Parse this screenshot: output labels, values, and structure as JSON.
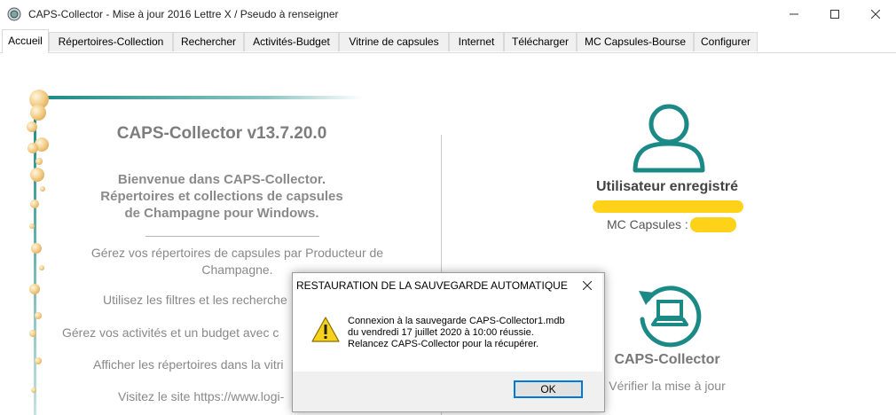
{
  "window": {
    "title": "CAPS-Collector - Mise à jour 2016 Lettre X / Pseudo à renseigner",
    "icon": "caps-icon",
    "controls": [
      "minimize-icon",
      "maximize-icon",
      "close-icon"
    ]
  },
  "tabs": [
    {
      "label": "Accueil",
      "active": true
    },
    {
      "label": "Répertoires-Collection"
    },
    {
      "label": "Rechercher"
    },
    {
      "label": "Activités-Budget"
    },
    {
      "label": "Vitrine de capsules"
    },
    {
      "label": "Internet"
    },
    {
      "label": "Télécharger"
    },
    {
      "label": "MC Capsules-Bourse"
    },
    {
      "label": "Configurer"
    }
  ],
  "home": {
    "title": "CAPS-Collector v13.7.20.0",
    "welcome": [
      "Bienvenue dans CAPS-Collector.",
      "Répertoires et collections de capsules",
      "de Champagne pour Windows."
    ],
    "feature_1": [
      "Gérez vos répertoires de capsules par Producteur de",
      "Champagne."
    ],
    "feature_2": "Utilisez les filtres et les recherche",
    "feature_3": "Gérez vos activités et un budget avec c",
    "feature_4": "Afficher les répertoires dans la vitri",
    "feature_5": "Visitez le site https://www.logi-"
  },
  "user": {
    "status": "Utilisateur enregistré",
    "mc_label": "MC Capsules :"
  },
  "update": {
    "title": "CAPS-Collector",
    "subtitle": "Vérifier la mise à jour"
  },
  "dialog": {
    "title": "RESTAURATION DE LA SAUVEGARDE AUTOMATIQUE",
    "lines": [
      "Connexion à la sauvegarde CAPS-Collector1.mdb",
      "du vendredi 17 juillet 2020 à 10:00 réussie.",
      "Relancez CAPS-Collector pour la récupérer."
    ],
    "ok_label": "OK",
    "icon": "warning-icon"
  },
  "colors": {
    "accent": "#1b8a86",
    "highlight": "#ffd21a",
    "bubble": "#f3cf8b",
    "muted_text": "#888888",
    "tab_bg": "#f0f0f0"
  }
}
